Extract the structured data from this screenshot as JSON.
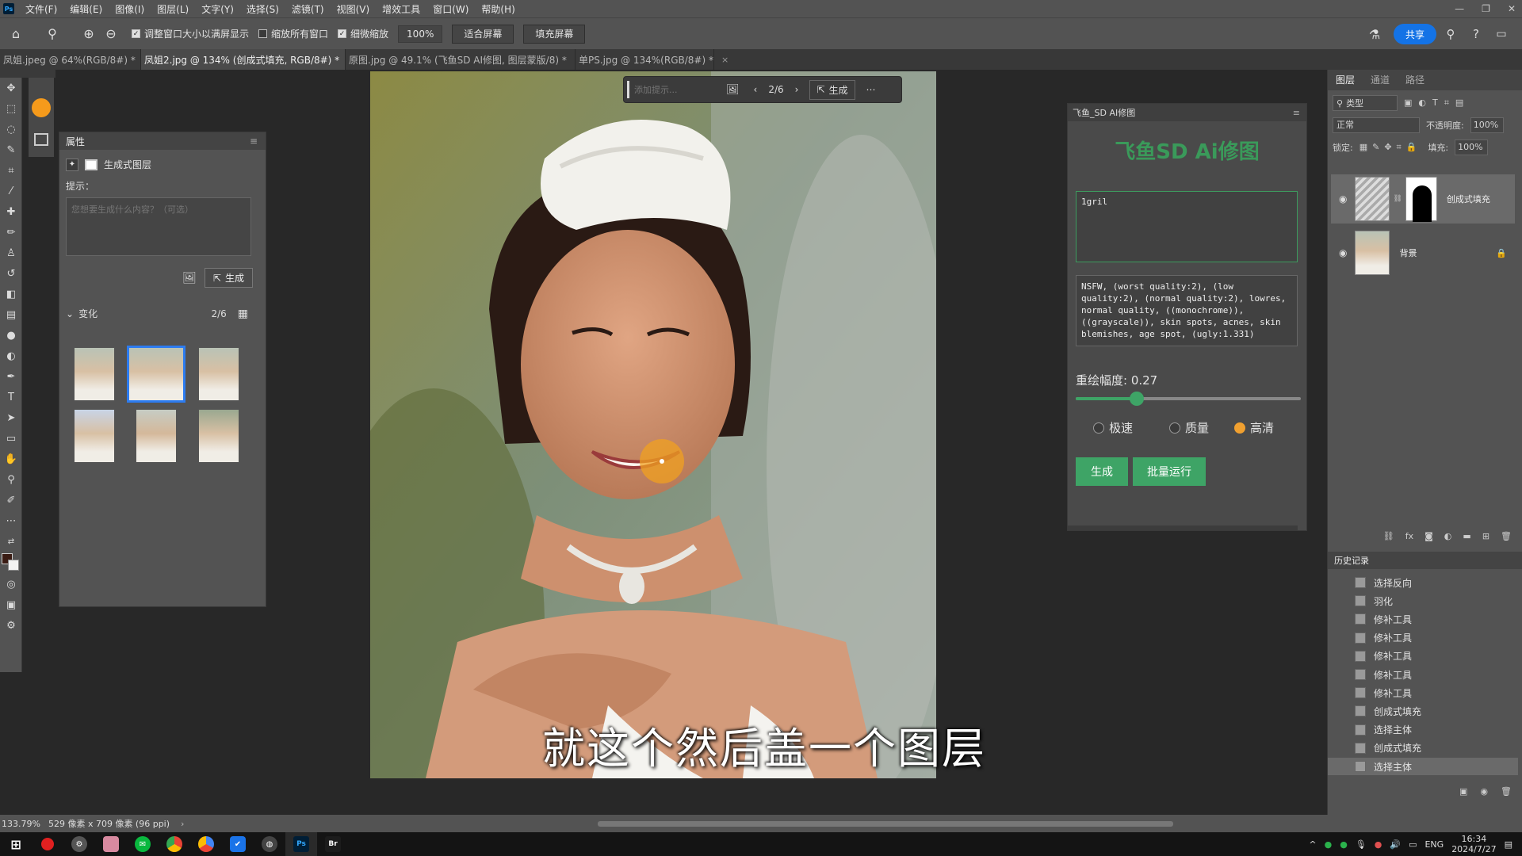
{
  "app": {
    "menu": [
      "文件(F)",
      "编辑(E)",
      "图像(I)",
      "图层(L)",
      "文字(Y)",
      "选择(S)",
      "滤镜(T)",
      "视图(V)",
      "增效工具",
      "窗口(W)",
      "帮助(H)"
    ],
    "ps_logo": "Ps"
  },
  "options": {
    "resize_windows": "调整窗口大小以满屏显示",
    "zoom_all": "缩放所有窗口",
    "scrubby_zoom": "细微缩放",
    "zoom_value": "100%",
    "fit_screen": "适合屏幕",
    "fill_screen": "填充屏幕",
    "share": "共享"
  },
  "tabs": [
    "凤姐.jpeg @ 64%(RGB/8#) *",
    "凤姐2.jpg @ 134% (创成式填充, RGB/8#) *",
    "原图.jpg @ 49.1% (飞鱼SD AI修图, 图层蒙版/8) *",
    "单PS.jpg @ 134%(RGB/8#) *"
  ],
  "props": {
    "title": "属性",
    "layer_type": "生成式图层",
    "prompt_label": "提示：",
    "prompt_placeholder": "您想要生成什么内容？（可选）",
    "generate": "生成",
    "variations_label": "变化",
    "variations_count": "2/6"
  },
  "context_bar": {
    "placeholder": "添加提示...",
    "page": "2/6",
    "generate": "生成"
  },
  "plugin": {
    "panel_title": "飞鱼_SD AI修图",
    "title": "飞鱼SD Ai修图",
    "prompt": "1gril",
    "negative_prompt": "NSFW, (worst quality:2), (low quality:2), (normal quality:2), lowres, normal quality, ((monochrome)), ((grayscale)), skin spots, acnes, skin blemishes, age spot, (ugly:1.331)",
    "denoise_label": "重绘幅度: 0.27",
    "denoise_value": 0.27,
    "modes": [
      "极速",
      "质量",
      "高清"
    ],
    "selected_mode": "高清",
    "generate": "生成",
    "batch": "批量运行"
  },
  "layers": {
    "tabs": [
      "图层",
      "通道",
      "路径"
    ],
    "kind_label": "类型",
    "blend_mode": "正常",
    "opacity_label": "不透明度:",
    "opacity": "100%",
    "lock_label": "锁定:",
    "fill_label": "填充:",
    "fill": "100%",
    "items": [
      {
        "name": "创成式填充"
      },
      {
        "name": "背景"
      }
    ]
  },
  "history": {
    "title": "历史记录",
    "items": [
      "选择反向",
      "羽化",
      "修补工具",
      "修补工具",
      "修补工具",
      "修补工具",
      "修补工具",
      "创成式填充",
      "选择主体",
      "创成式填充",
      "选择主体"
    ]
  },
  "status": {
    "zoom": "133.79%",
    "doc_info": "529 像素 x 709 像素 (96 ppi)"
  },
  "subtitle": "就这个然后盖一个图层",
  "taskbar": {
    "lang": "ENG",
    "time": "16:34",
    "date": "2024/7/27"
  },
  "colors": {
    "accent_blue": "#1473e6",
    "plugin_green": "#3ea466",
    "radio_selected": "#f0a030"
  }
}
